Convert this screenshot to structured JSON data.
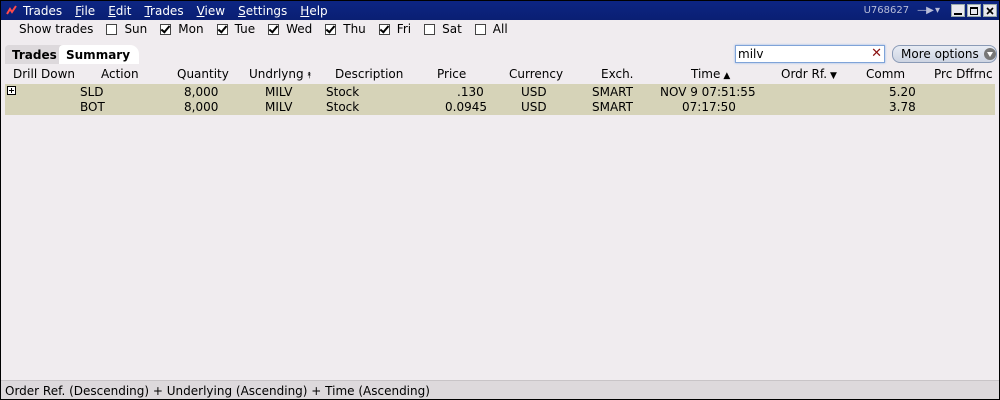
{
  "menubar": {
    "items": [
      {
        "label": "Trades"
      },
      {
        "label": "File",
        "ul": "F",
        "rest": "ile"
      },
      {
        "label": "Edit",
        "ul": "E",
        "rest": "dit"
      },
      {
        "label": "Trades",
        "ul": "T",
        "rest": "rades"
      },
      {
        "label": "View",
        "ul": "V",
        "rest": "iew"
      },
      {
        "label": "Settings",
        "ul": "S",
        "rest": "ettings"
      },
      {
        "label": "Help",
        "ul": "H",
        "rest": "elp"
      }
    ],
    "account": "U768627"
  },
  "filter": {
    "label": "Show trades",
    "days": [
      {
        "label": "Sun",
        "checked": false
      },
      {
        "label": "Mon",
        "checked": true
      },
      {
        "label": "Tue",
        "checked": true
      },
      {
        "label": "Wed",
        "checked": true
      },
      {
        "label": "Thu",
        "checked": true
      },
      {
        "label": "Fri",
        "checked": true
      },
      {
        "label": "Sat",
        "checked": false
      },
      {
        "label": "All",
        "checked": false
      }
    ]
  },
  "tabs": {
    "trades": "Trades",
    "summary": "Summary"
  },
  "search": {
    "value": "milv"
  },
  "more_options": "More options",
  "table": {
    "columns": {
      "drill_down": "Drill Down",
      "action": "Action",
      "quantity": "Quantity",
      "underlying": "Undrlyng",
      "description": "Description",
      "price": "Price",
      "currency": "Currency",
      "exchange": "Exch.",
      "time": "Time",
      "order_ref": "Ordr Rf.",
      "comm": "Comm",
      "prc_diff": "Prc Dffrnc"
    },
    "rows": [
      {
        "action": "SLD",
        "quantity": "8,000",
        "underlying": "MILV",
        "description": "Stock",
        "price": ".130",
        "currency": "USD",
        "exchange": "SMART",
        "time": "NOV 9 07:51:55",
        "comm": "5.20"
      },
      {
        "action": "BOT",
        "quantity": "8,000",
        "underlying": "MILV",
        "description": "Stock",
        "price": "0.0945",
        "currency": "USD",
        "exchange": "SMART",
        "time": "07:17:50",
        "comm": "3.78"
      }
    ]
  },
  "footer": {
    "sort_text": "Order Ref. (Descending)  +  Underlying (Ascending)  +  Time (Ascending)"
  }
}
